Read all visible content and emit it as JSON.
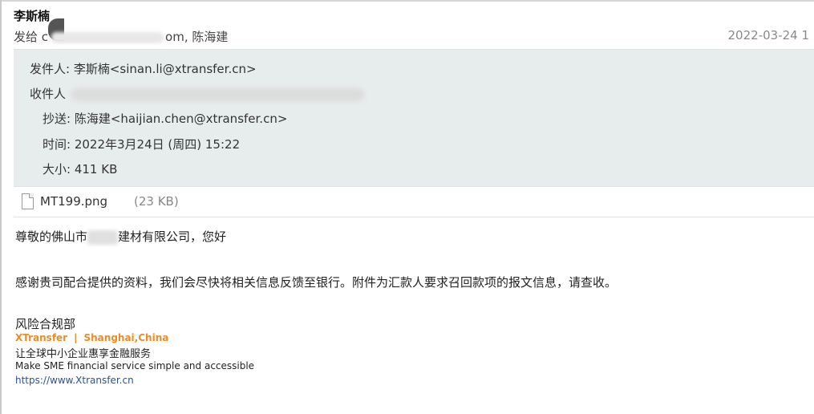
{
  "header": {
    "sender_name": "李斯楠",
    "to_prefix": "发给",
    "to_visible_start": "c",
    "to_visible_end": "om, 陈海建",
    "date": "2022-03-24 1"
  },
  "details": {
    "from_label": "发件人:",
    "from_value": "李斯楠<sinan.li@xtransfer.cn>",
    "to_label": "收件人",
    "cc_label": "抄送:",
    "cc_value": "陈海建<haijian.chen@xtransfer.cn>",
    "time_label": "时间:",
    "time_value": "2022年3月24日 (周四) 15:22",
    "size_label": "大小:",
    "size_value": "411 KB"
  },
  "attachment": {
    "name": "MT199.png",
    "size": "(23 KB)"
  },
  "body": {
    "greeting_start": "尊敬的佛山市",
    "greeting_end": "建材有限公司，您好",
    "message": "感谢贵司配合提供的资料，我们会尽快将相关信息反馈至银行。附件为汇款人要求召回款项的报文信息，请查收。"
  },
  "signature": {
    "department": "风险合规部",
    "brand": "XTransfer",
    "separator": "|",
    "location": "Shanghai,China",
    "slogan_cn": "让全球中小企业惠享金融服务",
    "slogan_en": "Make SME financial service simple and accessible",
    "link": "https://www.Xtransfer.cn"
  },
  "colors": {
    "detail_bg": "#e7ecec",
    "brand_orange": "#f08a24",
    "link_blue": "#2a4f9e"
  },
  "icons": [
    "file-icon"
  ]
}
